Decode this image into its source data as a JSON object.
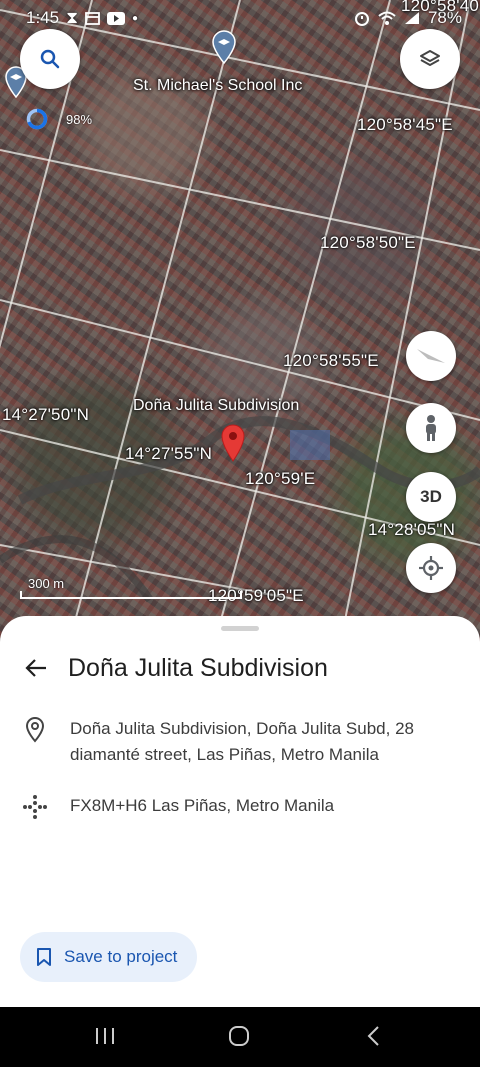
{
  "status_bar": {
    "time": "1:45",
    "battery": "78%",
    "icons": [
      "hourglass-icon",
      "window-icon",
      "youtube-icon",
      "dot-icon",
      "alarm-icon",
      "wifi-icon",
      "signal-icon",
      "battery-icon"
    ]
  },
  "map": {
    "places": {
      "school": "St. Michael's School Inc",
      "subdivision": "Doña Julita Subdivision"
    },
    "coordinates": {
      "c1": "120°58'45\"E",
      "c2": "120°58'50\"E",
      "c3": "120°58'55\"E",
      "c4": "14°27'50\"N",
      "c5": "14°27'55\"N",
      "c6": "120°59'E",
      "c7": "14°28'05\"N",
      "c8": "120°59'05\"E",
      "c9": "120°58'40"
    },
    "location_accuracy": "98%",
    "scale_label": "300 m",
    "three_d_label": "3D",
    "buttons": [
      "search-icon",
      "layers-icon",
      "compass-icon",
      "pegman-icon",
      "3d-button",
      "my-location-icon"
    ]
  },
  "sheet": {
    "title": "Doña Julita Subdivision",
    "address": "Doña Julita Subdivision, Doña Julita Subd, 28 diamanté street, Las Piñas, Metro Manila",
    "plus_code": "FX8M+H6 Las Piñas, Metro Manila",
    "save_label": "Save to project"
  },
  "colors": {
    "accent": "#1a56b0",
    "save_bg": "#e8f0fb",
    "pin": "#e53935",
    "my_location": "#1a73e8"
  }
}
